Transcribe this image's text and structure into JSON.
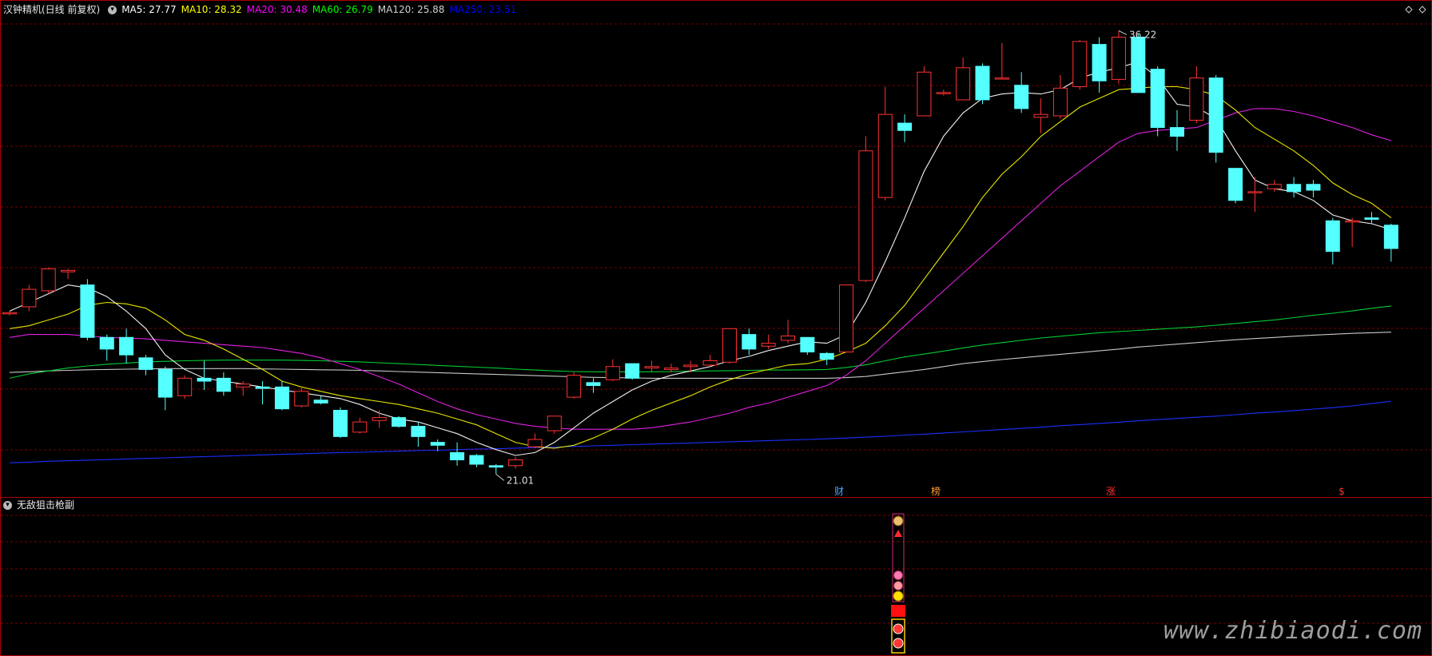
{
  "top_panel": {
    "title": "汉钟精机(日线 前复权)",
    "ma_labels": [
      {
        "text": "MA5: 27.77",
        "color": "#ffffff"
      },
      {
        "text": "MA10: 28.32",
        "color": "#ffff00"
      },
      {
        "text": "MA20: 30.48",
        "color": "#ff00ff"
      },
      {
        "text": "MA60: 26.79",
        "color": "#00ff00"
      },
      {
        "text": "MA120: 25.88",
        "color": "#d0d0d0"
      },
      {
        "text": "MA250: 23.51",
        "color": "#0000ff"
      }
    ],
    "high_label": "36.22",
    "low_label": "21.01",
    "event_markers": [
      {
        "text": "财",
        "color": "#4aa3ff"
      },
      {
        "text": "榜",
        "color": "#ff9933"
      },
      {
        "text": "涨",
        "color": "#ff3030"
      },
      {
        "text": "$",
        "color": "#ff3030"
      }
    ]
  },
  "bottom_panel": {
    "title": "无敌狙击枪副"
  },
  "watermark": "www.zhibiaodi.com",
  "colors": {
    "up": "#ff3232",
    "down": "#54ffff",
    "grid": "#7a0000",
    "border": "#aa0000"
  },
  "chart_data": {
    "type": "candlestick",
    "candles": [
      [
        26.55,
        26.55,
        26.45,
        26.6
      ],
      [
        26.75,
        27.35,
        26.6,
        27.5
      ],
      [
        27.3,
        28.05,
        27.2,
        28.1
      ],
      [
        27.95,
        28.0,
        27.7,
        28.05
      ],
      [
        27.5,
        25.7,
        25.6,
        27.7
      ],
      [
        25.7,
        25.3,
        24.9,
        25.8
      ],
      [
        25.7,
        25.1,
        24.8,
        26.0
      ],
      [
        25.0,
        24.6,
        24.4,
        25.1
      ],
      [
        24.6,
        23.65,
        23.2,
        24.7
      ],
      [
        23.7,
        24.3,
        23.6,
        24.4
      ],
      [
        24.3,
        24.2,
        23.9,
        24.9
      ],
      [
        24.3,
        23.85,
        23.7,
        24.5
      ],
      [
        24.0,
        24.1,
        23.7,
        24.2
      ],
      [
        24.0,
        23.95,
        23.4,
        24.2
      ],
      [
        24.0,
        23.25,
        23.2,
        24.2
      ],
      [
        23.35,
        23.85,
        23.3,
        24.0
      ],
      [
        23.55,
        23.45,
        23.4,
        23.7
      ],
      [
        23.2,
        22.3,
        22.25,
        23.3
      ],
      [
        22.45,
        22.8,
        22.4,
        22.95
      ],
      [
        22.85,
        22.95,
        22.6,
        23.2
      ],
      [
        22.95,
        22.65,
        22.6,
        23.0
      ],
      [
        22.65,
        22.3,
        21.95,
        22.8
      ],
      [
        22.1,
        22.0,
        21.8,
        22.2
      ],
      [
        21.75,
        21.5,
        21.3,
        22.1
      ],
      [
        21.65,
        21.35,
        21.25,
        21.7
      ],
      [
        21.3,
        21.25,
        21.01,
        21.35
      ],
      [
        21.3,
        21.5,
        21.2,
        21.6
      ],
      [
        21.95,
        22.2,
        21.9,
        22.4
      ],
      [
        22.5,
        23.0,
        22.4,
        23.0
      ],
      [
        23.65,
        24.4,
        23.6,
        24.5
      ],
      [
        24.15,
        24.05,
        23.8,
        24.3
      ],
      [
        24.25,
        24.7,
        24.2,
        24.95
      ],
      [
        24.8,
        24.3,
        24.25,
        24.8
      ],
      [
        24.65,
        24.7,
        24.5,
        24.9
      ],
      [
        24.6,
        24.65,
        24.5,
        24.8
      ],
      [
        24.7,
        24.75,
        24.5,
        24.9
      ],
      [
        24.75,
        24.9,
        24.7,
        25.1
      ],
      [
        24.85,
        26.0,
        24.8,
        26.0
      ],
      [
        25.8,
        25.3,
        25.1,
        26.0
      ],
      [
        25.4,
        25.5,
        25.3,
        25.8
      ],
      [
        25.6,
        25.75,
        25.5,
        26.3
      ],
      [
        25.7,
        25.2,
        25.1,
        25.7
      ],
      [
        25.15,
        24.95,
        24.75,
        25.2
      ],
      [
        25.2,
        27.5,
        25.2,
        27.5
      ],
      [
        27.65,
        32.1,
        27.6,
        32.6
      ],
      [
        30.5,
        33.35,
        30.4,
        34.3
      ],
      [
        33.05,
        32.8,
        32.4,
        33.35
      ],
      [
        33.3,
        34.8,
        33.3,
        35.0
      ],
      [
        34.1,
        34.1,
        34.0,
        34.2
      ],
      [
        33.85,
        34.95,
        33.85,
        35.3
      ],
      [
        35.0,
        33.85,
        33.7,
        35.1
      ],
      [
        34.6,
        34.6,
        34.6,
        35.8
      ],
      [
        34.35,
        33.55,
        33.4,
        34.8
      ],
      [
        33.25,
        33.35,
        32.7,
        33.9
      ],
      [
        33.3,
        34.25,
        33.2,
        34.7
      ],
      [
        34.3,
        35.85,
        34.2,
        35.9
      ],
      [
        35.75,
        34.5,
        34.1,
        36.0
      ],
      [
        34.55,
        36.0,
        34.4,
        36.22
      ],
      [
        36.0,
        34.1,
        34.1,
        36.1
      ],
      [
        34.9,
        32.9,
        32.6,
        35.0
      ],
      [
        32.9,
        32.6,
        32.1,
        33.5
      ],
      [
        33.15,
        34.6,
        33.05,
        35.0
      ],
      [
        34.6,
        32.05,
        31.7,
        34.7
      ],
      [
        31.5,
        30.4,
        30.3,
        31.5
      ],
      [
        30.7,
        30.7,
        30.0,
        31.2
      ],
      [
        30.8,
        30.95,
        30.7,
        31.1
      ],
      [
        30.95,
        30.7,
        30.5,
        31.2
      ],
      [
        30.95,
        30.75,
        30.5,
        31.1
      ],
      [
        29.7,
        28.65,
        28.2,
        29.8
      ],
      [
        29.7,
        29.7,
        28.8,
        29.8
      ],
      [
        29.8,
        29.75,
        29.6,
        30.0
      ],
      [
        29.55,
        28.75,
        28.3,
        29.6
      ]
    ],
    "ma5": [
      26.6,
      26.9,
      27.2,
      27.5,
      27.4,
      27.1,
      26.6,
      26.0,
      25.1,
      24.6,
      24.3,
      24.2,
      24.1,
      24.0,
      23.9,
      23.8,
      23.7,
      23.6,
      23.4,
      23.1,
      22.9,
      22.8,
      22.6,
      22.4,
      22.1,
      21.85,
      21.65,
      21.75,
      22.1,
      22.6,
      23.1,
      23.5,
      23.9,
      24.2,
      24.4,
      24.55,
      24.7,
      24.9,
      25.05,
      25.25,
      25.4,
      25.55,
      25.5,
      25.8,
      26.9,
      28.3,
      29.8,
      31.4,
      32.6,
      33.4,
      33.9,
      34.05,
      34.1,
      34.05,
      34.2,
      34.6,
      34.8,
      34.95,
      35.15,
      34.6,
      33.7,
      33.6,
      33.2,
      32.1,
      31.1,
      30.8,
      30.7,
      30.4,
      29.9,
      29.7,
      29.6,
      29.4
    ],
    "ma10": [
      26.0,
      26.1,
      26.3,
      26.5,
      26.8,
      26.9,
      26.85,
      26.7,
      26.3,
      25.8,
      25.6,
      25.3,
      24.95,
      24.6,
      24.2,
      24.0,
      23.85,
      23.7,
      23.6,
      23.5,
      23.4,
      23.25,
      23.1,
      22.9,
      22.7,
      22.4,
      22.1,
      21.95,
      21.9,
      22.0,
      22.25,
      22.55,
      22.9,
      23.2,
      23.45,
      23.7,
      24.0,
      24.25,
      24.45,
      24.6,
      24.75,
      24.8,
      24.95,
      25.2,
      25.5,
      26.1,
      26.8,
      27.7,
      28.6,
      29.5,
      30.5,
      31.3,
      31.9,
      32.6,
      33.1,
      33.6,
      33.9,
      34.2,
      34.25,
      34.3,
      34.3,
      34.2,
      34.0,
      33.5,
      32.9,
      32.5,
      32.1,
      31.6,
      31.0,
      30.6,
      30.3,
      29.8
    ],
    "ma20": [
      25.7,
      25.8,
      25.8,
      25.8,
      25.75,
      25.7,
      25.68,
      25.65,
      25.6,
      25.55,
      25.5,
      25.45,
      25.4,
      25.35,
      25.25,
      25.15,
      25.0,
      24.8,
      24.6,
      24.35,
      24.1,
      23.8,
      23.5,
      23.25,
      23.05,
      22.9,
      22.75,
      22.65,
      22.6,
      22.55,
      22.55,
      22.55,
      22.55,
      22.6,
      22.7,
      22.8,
      22.95,
      23.1,
      23.3,
      23.45,
      23.65,
      23.85,
      24.05,
      24.4,
      24.9,
      25.5,
      26.1,
      26.7,
      27.3,
      27.9,
      28.5,
      29.1,
      29.7,
      30.3,
      30.9,
      31.4,
      31.9,
      32.4,
      32.7,
      32.8,
      32.85,
      32.9,
      33.15,
      33.4,
      33.55,
      33.55,
      33.45,
      33.3,
      33.1,
      32.9,
      32.65,
      32.45
    ],
    "ma60": [
      24.3,
      24.45,
      24.55,
      24.65,
      24.72,
      24.78,
      24.82,
      24.86,
      24.88,
      24.9,
      24.91,
      24.92,
      24.92,
      24.92,
      24.92,
      24.91,
      24.9,
      24.88,
      24.86,
      24.83,
      24.8,
      24.77,
      24.74,
      24.71,
      24.68,
      24.65,
      24.61,
      24.58,
      24.55,
      24.53,
      24.52,
      24.52,
      24.52,
      24.52,
      24.53,
      24.54,
      24.55,
      24.56,
      24.57,
      24.58,
      24.58,
      24.59,
      24.6,
      24.67,
      24.76,
      24.9,
      25.03,
      25.13,
      25.23,
      25.34,
      25.44,
      25.52,
      25.6,
      25.68,
      25.74,
      25.8,
      25.86,
      25.9,
      25.94,
      25.98,
      26.02,
      26.06,
      26.12,
      26.18,
      26.24,
      26.3,
      26.38,
      26.46,
      26.53,
      26.61,
      26.7,
      26.78
    ],
    "ma120": [
      24.5,
      24.52,
      24.55,
      24.57,
      24.59,
      24.6,
      24.61,
      24.62,
      24.63,
      24.63,
      24.63,
      24.63,
      24.63,
      24.62,
      24.61,
      24.6,
      24.59,
      24.58,
      24.57,
      24.55,
      24.53,
      24.51,
      24.49,
      24.47,
      24.45,
      24.43,
      24.41,
      24.39,
      24.37,
      24.35,
      24.33,
      24.32,
      24.31,
      24.3,
      24.3,
      24.3,
      24.3,
      24.3,
      24.3,
      24.3,
      24.3,
      24.3,
      24.3,
      24.32,
      24.36,
      24.44,
      24.52,
      24.6,
      24.7,
      24.8,
      24.87,
      24.94,
      25.0,
      25.06,
      25.12,
      25.18,
      25.24,
      25.3,
      25.37,
      25.42,
      25.47,
      25.52,
      25.57,
      25.62,
      25.66,
      25.7,
      25.74,
      25.78,
      25.81,
      25.84,
      25.86,
      25.88
    ],
    "ma250": [
      21.4,
      21.42,
      21.45,
      21.47,
      21.49,
      21.51,
      21.53,
      21.55,
      21.57,
      21.59,
      21.61,
      21.63,
      21.65,
      21.67,
      21.69,
      21.71,
      21.73,
      21.75,
      21.76,
      21.78,
      21.8,
      21.82,
      21.83,
      21.85,
      21.87,
      21.88,
      21.9,
      21.92,
      21.94,
      21.96,
      21.98,
      22.0,
      22.02,
      22.04,
      22.06,
      22.08,
      22.1,
      22.12,
      22.14,
      22.16,
      22.18,
      22.2,
      22.22,
      22.25,
      22.28,
      22.31,
      22.35,
      22.38,
      22.42,
      22.46,
      22.5,
      22.54,
      22.58,
      22.62,
      22.67,
      22.71,
      22.75,
      22.79,
      22.84,
      22.88,
      22.92,
      22.96,
      23.0,
      23.05,
      23.1,
      23.14,
      23.19,
      23.24,
      23.29,
      23.35,
      23.43,
      23.51
    ],
    "y_range": [
      20.5,
      37.0
    ]
  }
}
